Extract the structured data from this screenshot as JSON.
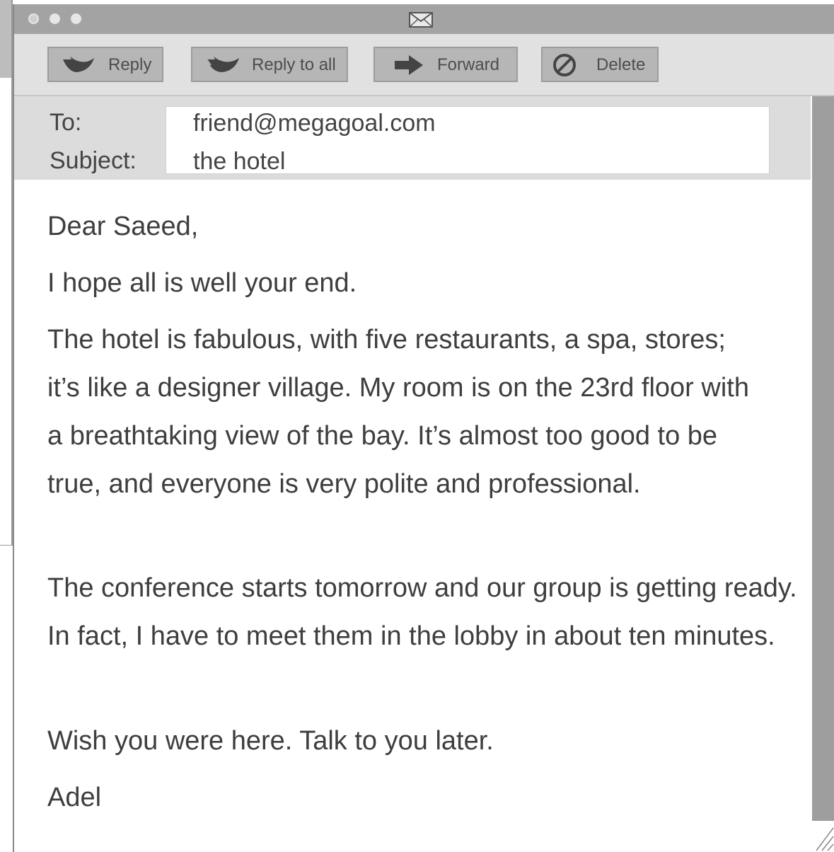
{
  "toolbar": {
    "reply_label": "Reply",
    "reply_all_label": "Reply to all",
    "forward_label": "Forward",
    "delete_label": "Delete"
  },
  "header": {
    "to_label": "To:",
    "to_value": "friend@megagoal.com",
    "subject_label": "Subject:",
    "subject_value": "the hotel"
  },
  "message": {
    "greeting": "Dear Saeed,",
    "opening": "I hope all is well your end.",
    "paragraph_1": "The hotel is fabulous, with five restaurants, a spa, stores; it’s like a designer village. My room is on the 23rd floor with a breathtaking view of the bay. It’s almost too good to be true, and everyone is very polite and professional.",
    "paragraph_2": "The conference starts tomorrow and our group is getting ready. In fact, I have to meet them in the lobby in about ten minutes.",
    "closing": "Wish you were here. Talk to you later.",
    "signature": "Adel"
  },
  "icons": {
    "title": "envelope-icon",
    "reply": "reply-arrow-icon",
    "reply_all": "reply-all-arrow-icon",
    "forward": "forward-arrow-icon",
    "delete": "no-entry-icon"
  }
}
